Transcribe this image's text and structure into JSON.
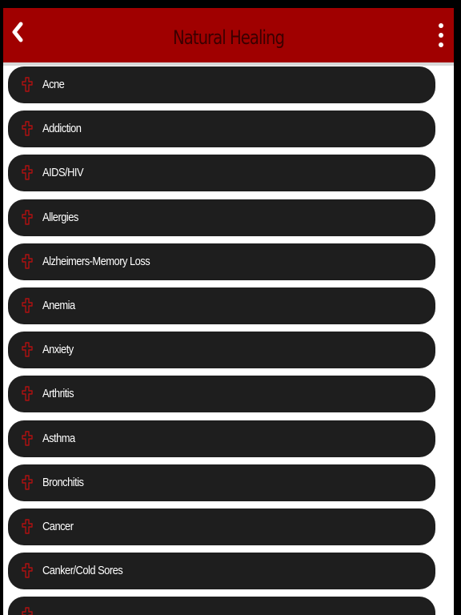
{
  "header": {
    "title": "Natural Healing",
    "back_icon": "chevron-left-icon",
    "menu_icon": "more-vertical-icon",
    "background_color": "#a00000",
    "title_color": "#3a0000"
  },
  "list": {
    "item_icon": "red-cross-outline-icon",
    "item_background_color": "#1e1e1e",
    "icon_color": "#b01010",
    "items": [
      {
        "label": "Acne"
      },
      {
        "label": "Addiction"
      },
      {
        "label": "AIDS/HIV"
      },
      {
        "label": "Allergies"
      },
      {
        "label": "Alzheimers-Memory Loss"
      },
      {
        "label": "Anemia"
      },
      {
        "label": "Anxiety"
      },
      {
        "label": "Arthritis"
      },
      {
        "label": "Asthma"
      },
      {
        "label": "Bronchitis"
      },
      {
        "label": "Cancer"
      },
      {
        "label": "Canker/Cold Sores"
      },
      {
        "label": ""
      }
    ]
  }
}
